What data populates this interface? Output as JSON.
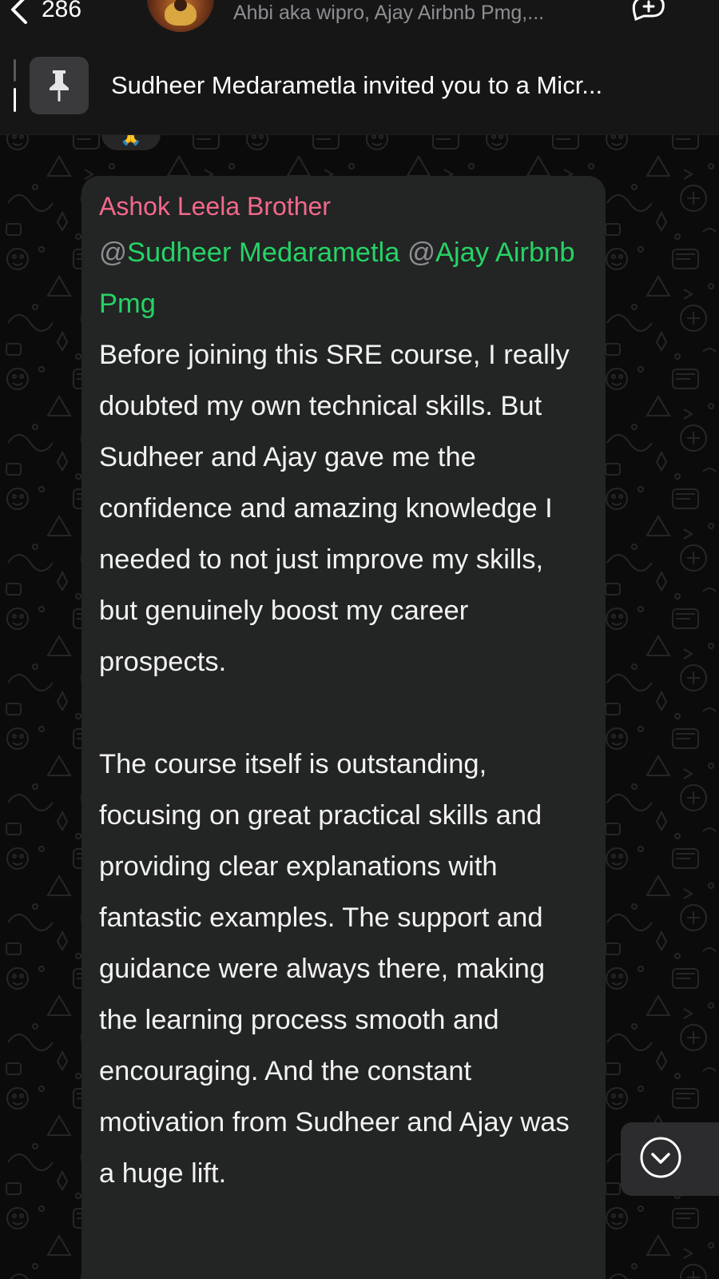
{
  "header": {
    "back_count": "286",
    "subtitle": "Ahbi aka wipro, Ajay Airbnb Pmg,...",
    "back_icon": "chevron-left-icon",
    "call_icon": "add-call-icon"
  },
  "pinned": {
    "icon": "pin-icon",
    "text": "Sudheer Medarametla invited you to a Micr..."
  },
  "reaction_peek": {
    "emoji": "🙏"
  },
  "message": {
    "sender": "Ashok Leela Brother",
    "sender_color": "#f2698a",
    "mentions": [
      {
        "at": "@",
        "name": "Sudheer Medarametla"
      },
      {
        "at": "@",
        "name": "Ajay Airbnb Pmg"
      }
    ],
    "mention_color": "#25d366",
    "paragraph_1": "Before joining this SRE course, I really doubted my own technical skills. But Sudheer and Ajay gave me the confidence and amazing knowledge I needed to not just improve my skills, but genuinely boost my career prospects.",
    "paragraph_2": "The course itself is outstanding, focusing on great practical skills and providing clear explanations with fantastic examples. The support and guidance were always there, making the learning process smooth and encouraging. And the constant motivation from Sudheer and Ajay was a huge lift."
  },
  "scroll_button": {
    "icon": "chevron-down-circle-icon"
  },
  "colors": {
    "background": "#0b0b0b",
    "bar": "#161616",
    "bubble": "#232424",
    "accent_green": "#25d366"
  }
}
